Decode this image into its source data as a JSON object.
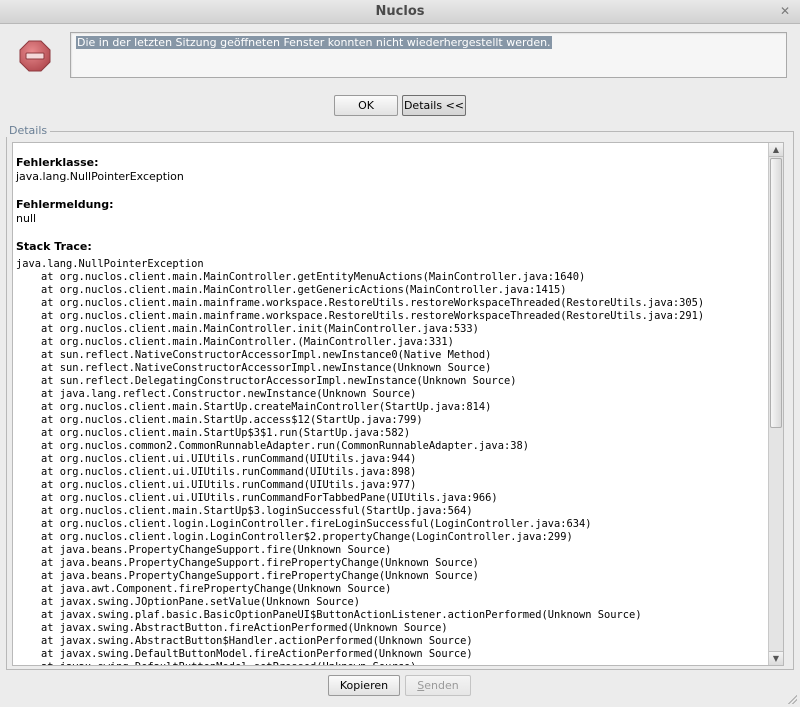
{
  "window": {
    "title": "Nuclos",
    "close_glyph": "✕"
  },
  "icons": {
    "stop": "stop-sign-icon",
    "close": "close-icon",
    "scroll_up": "arrow-up-icon",
    "scroll_down": "arrow-down-icon"
  },
  "colors": {
    "stop_sign": "#c0565b",
    "selection_bg": "#8696a6",
    "legend": "#6a7f95"
  },
  "message": {
    "text": "Die in der letzten Sitzung geöffneten Fenster konnten nicht wiederhergestellt werden."
  },
  "buttons": {
    "ok": "OK",
    "details": "Details <<",
    "kopieren": "Kopieren",
    "senden_first": "S",
    "senden_rest": "enden"
  },
  "details": {
    "legend": "Details",
    "fehlerklasse_label": "Fehlerklasse:",
    "fehlerklasse_value": "java.lang.NullPointerException",
    "fehlermeldung_label": "Fehlermeldung:",
    "fehlermeldung_value": "null",
    "stacktrace_label": "Stack Trace:",
    "stack_lines": [
      "java.lang.NullPointerException",
      "    at org.nuclos.client.main.MainController.getEntityMenuActions(MainController.java:1640)",
      "    at org.nuclos.client.main.MainController.getGenericActions(MainController.java:1415)",
      "    at org.nuclos.client.main.mainframe.workspace.RestoreUtils.restoreWorkspaceThreaded(RestoreUtils.java:305)",
      "    at org.nuclos.client.main.mainframe.workspace.RestoreUtils.restoreWorkspaceThreaded(RestoreUtils.java:291)",
      "    at org.nuclos.client.main.MainController.init(MainController.java:533)",
      "    at org.nuclos.client.main.MainController.(MainController.java:331)",
      "    at sun.reflect.NativeConstructorAccessorImpl.newInstance0(Native Method)",
      "    at sun.reflect.NativeConstructorAccessorImpl.newInstance(Unknown Source)",
      "    at sun.reflect.DelegatingConstructorAccessorImpl.newInstance(Unknown Source)",
      "    at java.lang.reflect.Constructor.newInstance(Unknown Source)",
      "    at org.nuclos.client.main.StartUp.createMainController(StartUp.java:814)",
      "    at org.nuclos.client.main.StartUp.access$12(StartUp.java:799)",
      "    at org.nuclos.client.main.StartUp$3$1.run(StartUp.java:582)",
      "    at org.nuclos.common2.CommonRunnableAdapter.run(CommonRunnableAdapter.java:38)",
      "    at org.nuclos.client.ui.UIUtils.runCommand(UIUtils.java:944)",
      "    at org.nuclos.client.ui.UIUtils.runCommand(UIUtils.java:898)",
      "    at org.nuclos.client.ui.UIUtils.runCommand(UIUtils.java:977)",
      "    at org.nuclos.client.ui.UIUtils.runCommandForTabbedPane(UIUtils.java:966)",
      "    at org.nuclos.client.main.StartUp$3.loginSuccessful(StartUp.java:564)",
      "    at org.nuclos.client.login.LoginController.fireLoginSuccessful(LoginController.java:634)",
      "    at org.nuclos.client.login.LoginController$2.propertyChange(LoginController.java:299)",
      "    at java.beans.PropertyChangeSupport.fire(Unknown Source)",
      "    at java.beans.PropertyChangeSupport.firePropertyChange(Unknown Source)",
      "    at java.beans.PropertyChangeSupport.firePropertyChange(Unknown Source)",
      "    at java.awt.Component.firePropertyChange(Unknown Source)",
      "    at javax.swing.JOptionPane.setValue(Unknown Source)",
      "    at javax.swing.plaf.basic.BasicOptionPaneUI$ButtonActionListener.actionPerformed(Unknown Source)",
      "    at javax.swing.AbstractButton.fireActionPerformed(Unknown Source)",
      "    at javax.swing.AbstractButton$Handler.actionPerformed(Unknown Source)",
      "    at javax.swing.DefaultButtonModel.fireActionPerformed(Unknown Source)",
      "    at javax.swing.DefaultButtonModel.setPressed(Unknown Source)"
    ]
  }
}
